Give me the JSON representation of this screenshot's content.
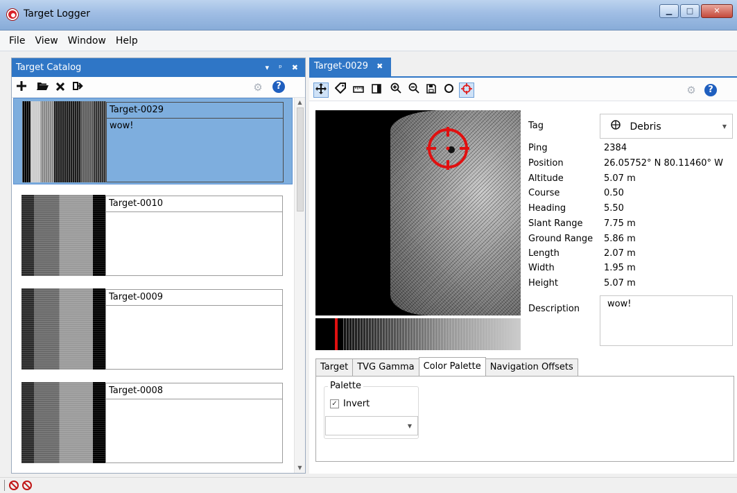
{
  "window": {
    "title": "Target Logger",
    "minimize": "▁",
    "maximize": "□",
    "close": "✕"
  },
  "menu": [
    "File",
    "View",
    "Window",
    "Help"
  ],
  "catalog": {
    "title": "Target Catalog",
    "header_icons": [
      "▾",
      "ᵖ",
      "✖"
    ],
    "help_label": "?",
    "items": [
      {
        "name": "Target-0029",
        "description": "wow!",
        "selected": true
      },
      {
        "name": "Target-0010",
        "description": ""
      },
      {
        "name": "Target-0009",
        "description": ""
      },
      {
        "name": "Target-0008",
        "description": ""
      }
    ]
  },
  "document": {
    "tab_label": "Target-0029",
    "tab_close": "✖",
    "help_label": "?",
    "tag": {
      "label": "Tag",
      "value": "Debris"
    },
    "properties": [
      {
        "label": "Ping",
        "value": "2384"
      },
      {
        "label": "Position",
        "value": "26.05752° N 80.11460° W"
      },
      {
        "label": "Altitude",
        "value": "5.07 m"
      },
      {
        "label": "Course",
        "value": "0.50"
      },
      {
        "label": "Heading",
        "value": "5.50"
      },
      {
        "label": "Slant Range",
        "value": "7.75 m"
      },
      {
        "label": "Ground Range",
        "value": "5.86 m"
      },
      {
        "label": "Length",
        "value": "2.07 m"
      },
      {
        "label": "Width",
        "value": "1.95 m"
      },
      {
        "label": "Height",
        "value": "5.07 m"
      }
    ],
    "description": {
      "label": "Description",
      "value": "wow!"
    },
    "tabs": [
      "Target",
      "TVG Gamma",
      "Color Palette",
      "Navigation Offsets"
    ],
    "active_tab": "Color Palette",
    "palette": {
      "group_title": "Palette",
      "invert_label": "Invert",
      "invert_checked": true,
      "selected": ""
    }
  },
  "colors": {
    "accent": "#2f76c6",
    "selection": "#7eaede",
    "reticle": "#e01010"
  }
}
